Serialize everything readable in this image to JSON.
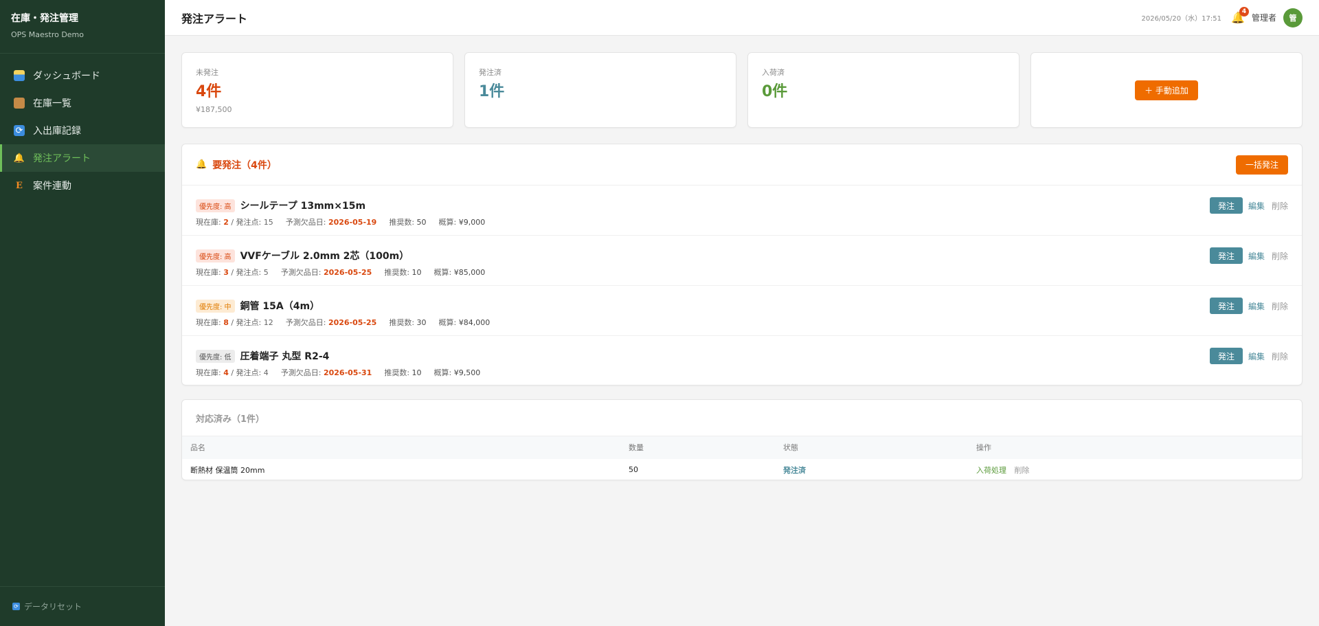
{
  "sidebar": {
    "brand_title": "在庫・発注管理",
    "brand_sub": "OPS Maestro Demo",
    "items": [
      {
        "label": "ダッシュボード",
        "icon": "chart-icon"
      },
      {
        "label": "在庫一覧",
        "icon": "box-icon"
      },
      {
        "label": "入出庫記録",
        "icon": "sync-icon"
      },
      {
        "label": "発注アラート",
        "icon": "bell-icon",
        "active": true
      },
      {
        "label": "案件連動",
        "icon": "e-icon"
      }
    ],
    "footer_label": "データリセット"
  },
  "header": {
    "title": "発注アラート",
    "datetime": "2026/05/20（水）17:51",
    "notification_count": "4",
    "user_name": "管理者",
    "avatar_initial": "管"
  },
  "stats": {
    "pending": {
      "label": "未発注",
      "value": "4件",
      "sub": "¥187,500"
    },
    "ordered": {
      "label": "発注済",
      "value": "1件"
    },
    "received": {
      "label": "入荷済",
      "value": "0件"
    },
    "manual_add_label": "＋ 手動追加"
  },
  "alerts": {
    "title": "要発注（4件）",
    "bulk_order_label": "一括発注",
    "rows": [
      {
        "priority": "優先度: 高",
        "name": "シールテープ 13mm×15m",
        "stock": "2",
        "reorder_point": "15",
        "shortage_date": "2026-05-19",
        "recommended": "50",
        "estimate": "¥9,000"
      },
      {
        "priority": "優先度: 高",
        "name": "VVFケーブル 2.0mm 2芯（100m）",
        "stock": "3",
        "reorder_point": "5",
        "shortage_date": "2026-05-25",
        "recommended": "10",
        "estimate": "¥85,000"
      },
      {
        "priority": "優先度: 中",
        "name": "銅管 15A（4m）",
        "stock": "8",
        "reorder_point": "12",
        "shortage_date": "2026-05-25",
        "recommended": "30",
        "estimate": "¥84,000"
      },
      {
        "priority": "優先度: 低",
        "name": "圧着端子 丸型 R2-4",
        "stock": "4",
        "reorder_point": "4",
        "shortage_date": "2026-05-31",
        "recommended": "10",
        "estimate": "¥9,500"
      }
    ],
    "labels": {
      "stock": "現在庫: ",
      "reorder_point": " / 発注点: ",
      "shortage_date": "予測欠品日: ",
      "recommended": "推奨数: ",
      "estimate": "概算: ",
      "order_btn": "発注",
      "edit": "編集",
      "delete": "削除"
    }
  },
  "done": {
    "title": "対応済み（1件）",
    "columns": [
      "品名",
      "数量",
      "状態",
      "操作"
    ],
    "rows": [
      {
        "name": "断熱材 保温筒 20mm",
        "qty": "50",
        "status": "発注済",
        "action_receive": "入荷処理",
        "action_delete": "削除"
      }
    ]
  },
  "colors": {
    "sidebar_bg": "#1f3b2a",
    "accent_green": "#6fbf5a",
    "accent_orange": "#ef6c00",
    "accent_red": "#d9480f",
    "accent_teal": "#4a8a9a"
  }
}
